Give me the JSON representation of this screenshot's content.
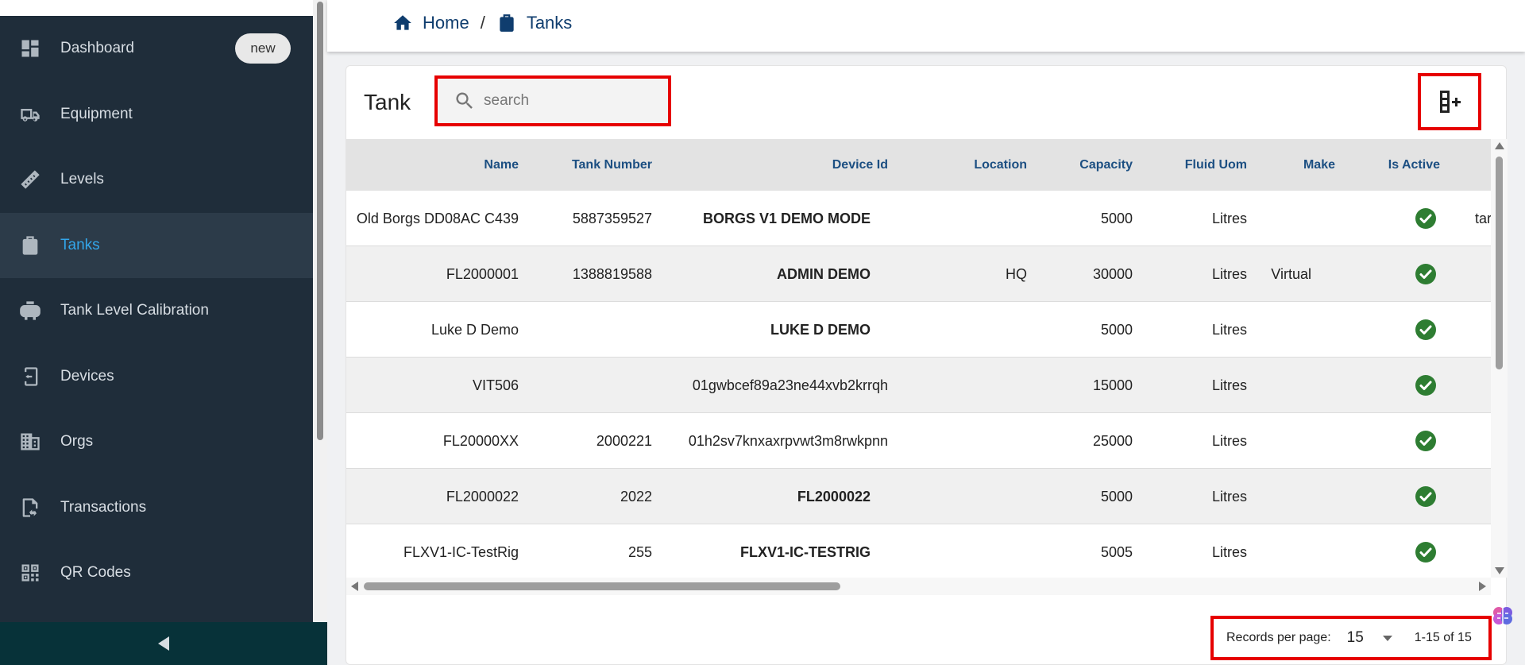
{
  "sidebar": {
    "items": [
      {
        "label": "Dashboard",
        "icon": "dashboard-icon",
        "badge": "new"
      },
      {
        "label": "Equipment",
        "icon": "truck-icon"
      },
      {
        "label": "Levels",
        "icon": "ruler-icon"
      },
      {
        "label": "Tanks",
        "icon": "tank-icon",
        "active": true
      },
      {
        "label": "Tank Level Calibration",
        "icon": "calibration-tank-icon"
      },
      {
        "label": "Devices",
        "icon": "device-icon"
      },
      {
        "label": "Orgs",
        "icon": "building-icon"
      },
      {
        "label": "Transactions",
        "icon": "transactions-icon"
      },
      {
        "label": "QR Codes",
        "icon": "qr-code-icon"
      }
    ],
    "active_color": "#33a6ea"
  },
  "breadcrumb": {
    "home": "Home",
    "separator": "/",
    "current": "Tanks"
  },
  "card": {
    "title": "Tank",
    "search_placeholder": "search"
  },
  "table": {
    "columns": [
      "Name",
      "Tank Number",
      "Device Id",
      "Location",
      "Capacity",
      "Fluid Uom",
      "Make",
      "Is Active"
    ],
    "rows": [
      {
        "name": "Old Borgs DD08AC C439",
        "tank_number": "5887359527",
        "device_id": "BORGS V1 DEMO MODE",
        "device_bold": true,
        "location": "",
        "capacity": "5000",
        "fluid_uom": "Litres",
        "make": "",
        "is_active": true,
        "extra": "tar"
      },
      {
        "name": "FL2000001",
        "tank_number": "1388819588",
        "device_id": "ADMIN DEMO",
        "device_bold": true,
        "location": "HQ",
        "capacity": "30000",
        "fluid_uom": "Litres",
        "make": "Virtual",
        "is_active": true,
        "extra": ""
      },
      {
        "name": "Luke D Demo",
        "tank_number": "",
        "device_id": "LUKE D DEMO",
        "device_bold": true,
        "location": "",
        "capacity": "5000",
        "fluid_uom": "Litres",
        "make": "",
        "is_active": true,
        "extra": ""
      },
      {
        "name": "VIT506",
        "tank_number": "",
        "device_id": "01gwbcef89a23ne44xvb2krrqh",
        "device_bold": false,
        "location": "",
        "capacity": "15000",
        "fluid_uom": "Litres",
        "make": "",
        "is_active": true,
        "extra": ""
      },
      {
        "name": "FL20000XX",
        "tank_number": "2000221",
        "device_id": "01h2sv7knxaxrpvwt3m8rwkpnn",
        "device_bold": false,
        "location": "",
        "capacity": "25000",
        "fluid_uom": "Litres",
        "make": "",
        "is_active": true,
        "extra": ""
      },
      {
        "name": "FL2000022",
        "tank_number": "2022",
        "device_id": "FL2000022",
        "device_bold": true,
        "location": "",
        "capacity": "5000",
        "fluid_uom": "Litres",
        "make": "",
        "is_active": true,
        "extra": ""
      },
      {
        "name": "FLXV1-IC-TestRig",
        "tank_number": "255",
        "device_id": "FLXV1-IC-TESTRIG",
        "device_bold": true,
        "location": "",
        "capacity": "5005",
        "fluid_uom": "Litres",
        "make": "",
        "is_active": true,
        "extra": ""
      }
    ]
  },
  "pagination": {
    "label": "Records per page:",
    "per_page": "15",
    "range": "1-15 of 15"
  },
  "colors": {
    "sidebar_bg": "#1f2d3a",
    "header_text": "#1c4f82",
    "active_check": "#2e7d32",
    "highlight_border": "#e60000"
  }
}
